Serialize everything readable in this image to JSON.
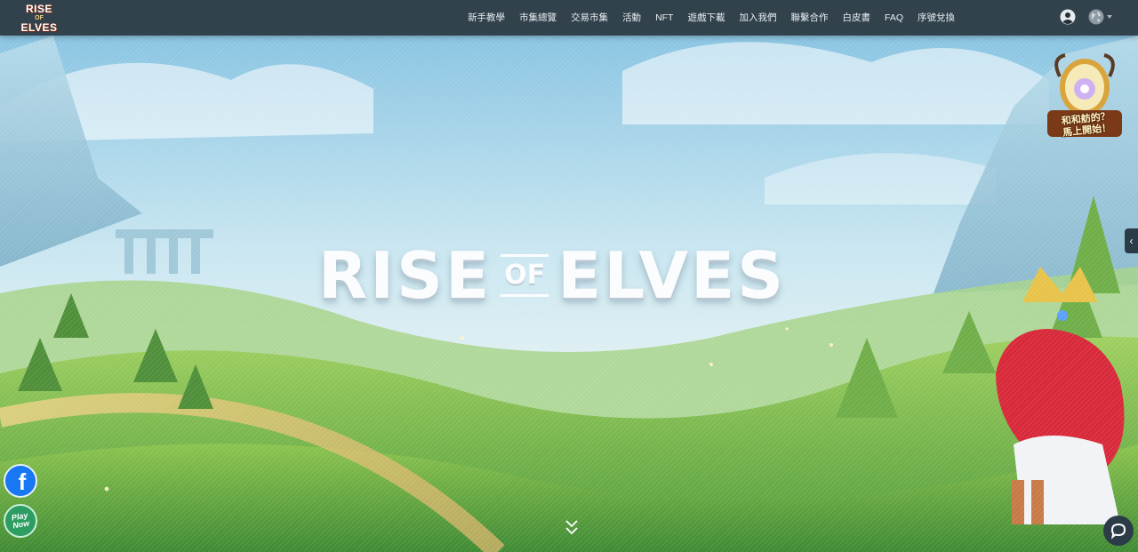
{
  "logo": {
    "line1": "RISE",
    "line2": "OF",
    "line3": "ELVES"
  },
  "nav": {
    "items": [
      "新手教學",
      "市集總覽",
      "交易市集",
      "活動",
      "NFT",
      "遊戲下載",
      "加入我們",
      "聯繫合作",
      "白皮書",
      "FAQ",
      "序號兌換"
    ]
  },
  "header_icons": {
    "account": "user-icon",
    "language": "globe-icon"
  },
  "hero": {
    "title_left": "RISE",
    "title_mid": "OF",
    "title_right": "ELVES"
  },
  "event_badge": {
    "line1": "和和舫的？",
    "line2": "馬上開始！"
  },
  "side_tab": {
    "icon": "chevron-left-icon",
    "glyph": "‹"
  },
  "social": {
    "facebook_glyph": "f",
    "playnow_line1": "Play",
    "playnow_line2": "Now"
  },
  "scroll_indicator": {
    "icon": "double-chevron-down-icon"
  },
  "chat": {
    "icon": "chat-bubble-icon"
  },
  "colors": {
    "navbar_bg": "#263038",
    "sky": "#8fc6e0",
    "grass": "#7fb84a",
    "title": "#fbfcfd",
    "facebook": "#1877f2",
    "playnow": "#2e9d63",
    "chat": "#2b3b47"
  }
}
